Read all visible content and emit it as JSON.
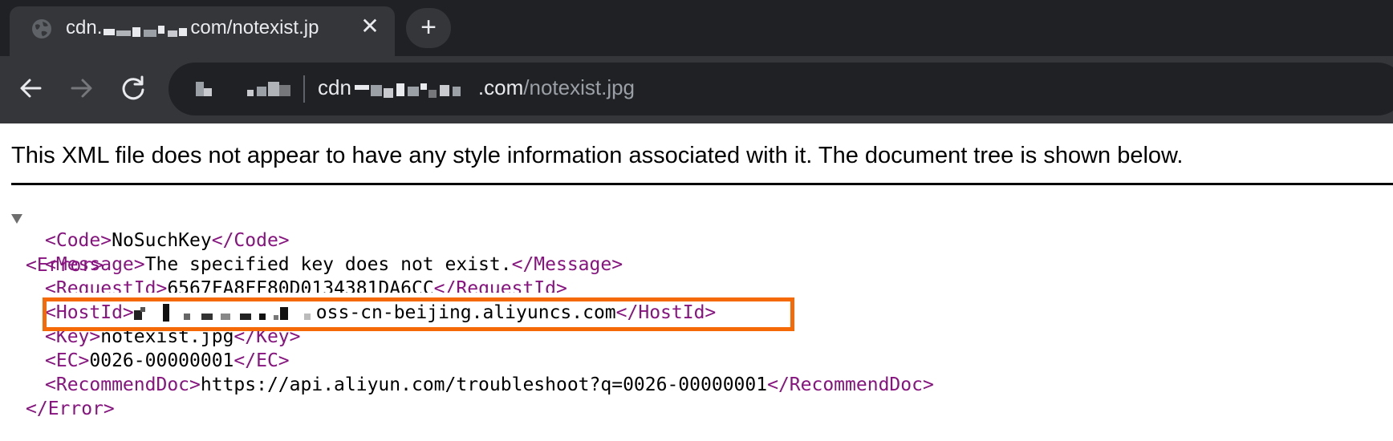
{
  "browser": {
    "tab": {
      "title_prefix": "cdn.",
      "title_suffix": "com/notexist.jp",
      "favicon": "globe-icon",
      "close": "✕"
    },
    "new_tab": "+",
    "nav": {
      "back": "arrow-left-icon",
      "forward": "arrow-right-icon",
      "reload": "reload-icon"
    },
    "omnibox": {
      "url_prefix": "cdn",
      "url_domain_suffix": ".com",
      "url_path": "/notexist.jpg"
    }
  },
  "page": {
    "notice": "This XML file does not appear to have any style information associated with it. The document tree is shown below.",
    "xml": {
      "root_open": "<Error>",
      "root_close": "</Error>",
      "rows": [
        {
          "open": "<Code>",
          "value": "NoSuchKey",
          "close": "</Code>"
        },
        {
          "open": "<Message>",
          "value": "The specified key does not exist.",
          "close": "</Message>"
        },
        {
          "open": "<RequestId>",
          "value": "6567FA8FF80D0134381DA6CC",
          "close": "</RequestId>"
        },
        {
          "open": "<HostId>",
          "value": "oss-cn-beijing.aliyuncs.com",
          "close": "</HostId>"
        },
        {
          "open": "<Key>",
          "value": "notexist.jpg",
          "close": "</Key>"
        },
        {
          "open": "<EC>",
          "value": "0026-00000001",
          "close": "</EC>"
        },
        {
          "open": "<RecommendDoc>",
          "value": "https://api.aliyun.com/troubleshoot?q=0026-00000001",
          "close": "</RecommendDoc>"
        }
      ]
    }
  },
  "colors": {
    "tag": "#881280",
    "highlight_border": "#f56a07",
    "chrome_bg": "#202124",
    "toolbar_bg": "#35363a"
  }
}
